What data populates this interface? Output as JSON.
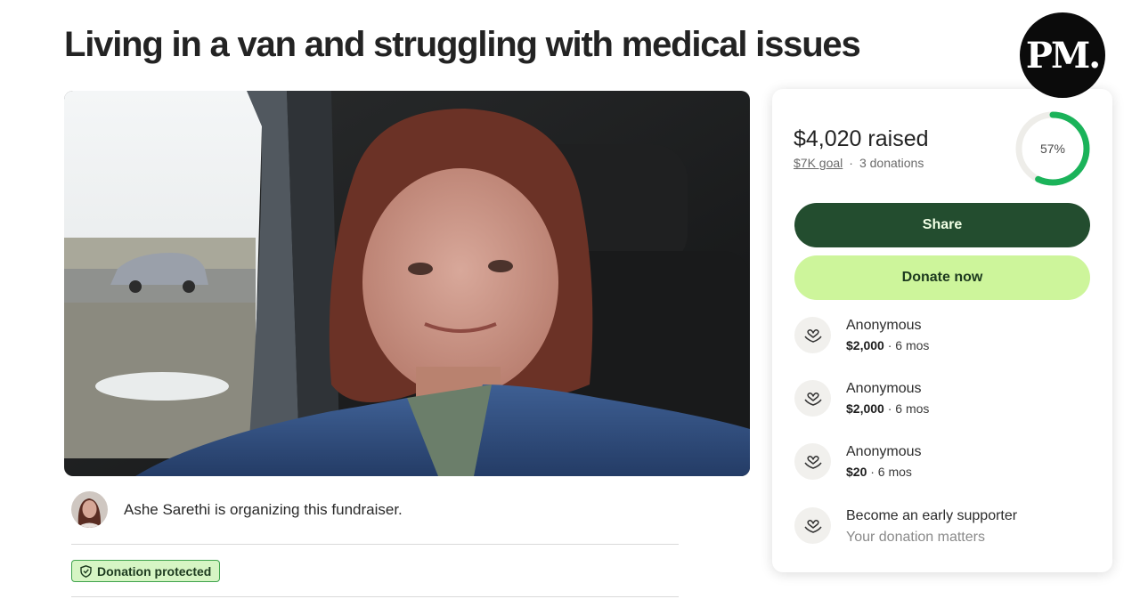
{
  "page": {
    "title": "Living in a van and struggling with medical issues"
  },
  "logo": {
    "text": "PM."
  },
  "organizer": {
    "text": "Ashe Sarethi is organizing this fundraiser."
  },
  "badge": {
    "label": "Donation protected",
    "icon": "shield-icon"
  },
  "donation_card": {
    "raised": "$4,020 raised",
    "goal": "$7K goal",
    "separator": "·",
    "donations_count": "3 donations",
    "progress_label": "57%",
    "progress_fraction": 0.57,
    "share_label": "Share",
    "donate_label": "Donate now",
    "donors": [
      {
        "name": "Anonymous",
        "amount": "$2,000",
        "time": " · 6 mos",
        "icon": "heart-hands-icon"
      },
      {
        "name": "Anonymous",
        "amount": "$2,000",
        "time": " · 6 mos",
        "icon": "heart-hands-icon"
      },
      {
        "name": "Anonymous",
        "amount": "$20",
        "time": " · 6 mos",
        "icon": "heart-hands-icon"
      }
    ],
    "early_supporter": {
      "title": "Become an early supporter",
      "subtitle": "Your donation matters",
      "icon": "heart-hands-icon"
    }
  },
  "colors": {
    "share_button": "#234d2f",
    "donate_button": "#cdf59b",
    "progress": "#1bb35a",
    "badge_border": "#3fa34d",
    "badge_bg": "#d6f5c4"
  }
}
